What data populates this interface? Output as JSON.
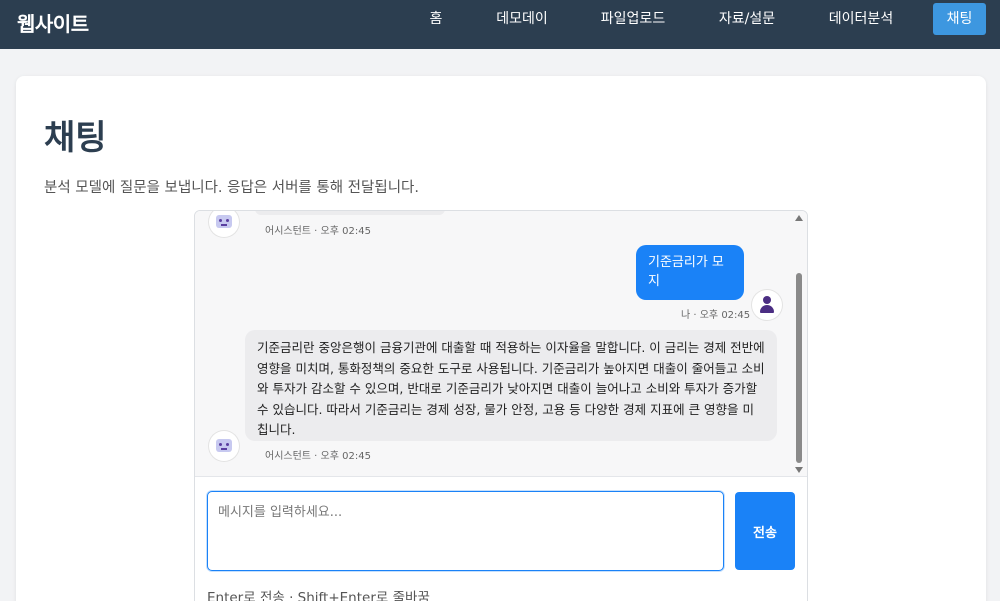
{
  "nav": {
    "brand": "웹사이트",
    "items": [
      {
        "label": "홈",
        "active": false
      },
      {
        "label": "데모데이",
        "active": false
      },
      {
        "label": "파일업로드",
        "active": false
      },
      {
        "label": "자료/설문",
        "active": false
      },
      {
        "label": "데이터분석",
        "active": false
      },
      {
        "label": "채팅",
        "active": true
      }
    ]
  },
  "page": {
    "title": "채팅",
    "description": "분석 모델에 질문을 보냅니다. 응답은 서버를 통해 전달됩니다."
  },
  "chat": {
    "messages": [
      {
        "role": "assistant",
        "meta": "어시스턴트 · 오후 02:45",
        "text": ""
      },
      {
        "role": "user",
        "meta": "나 · 오후 02:45",
        "text": "기준금리가 모지"
      },
      {
        "role": "assistant",
        "meta": "어시스턴트 · 오후 02:45",
        "text": "기준금리란 중앙은행이 금융기관에 대출할 때 적용하는 이자율을 말합니다. 이 금리는 경제 전반에 영향을 미치며, 통화정책의 중요한 도구로 사용됩니다. 기준금리가 높아지면 대출이 줄어들고 소비와 투자가 감소할 수 있으며, 반대로 기준금리가 낮아지면 대출이 늘어나고 소비와 투자가 증가할 수 있습니다. 따라서 기준금리는 경제 성장, 물가 안정, 고용 등 다양한 경제 지표에 큰 영향을 미칩니다."
      }
    ],
    "input": {
      "placeholder": "메시지를 입력하세요...",
      "value": ""
    },
    "send_label": "전송",
    "hint": "Enter로 전송 · Shift+Enter로 줄바꿈"
  },
  "colors": {
    "nav_bg": "#2c3e50",
    "accent": "#1a82f7",
    "active_tab": "#3d97e0"
  }
}
